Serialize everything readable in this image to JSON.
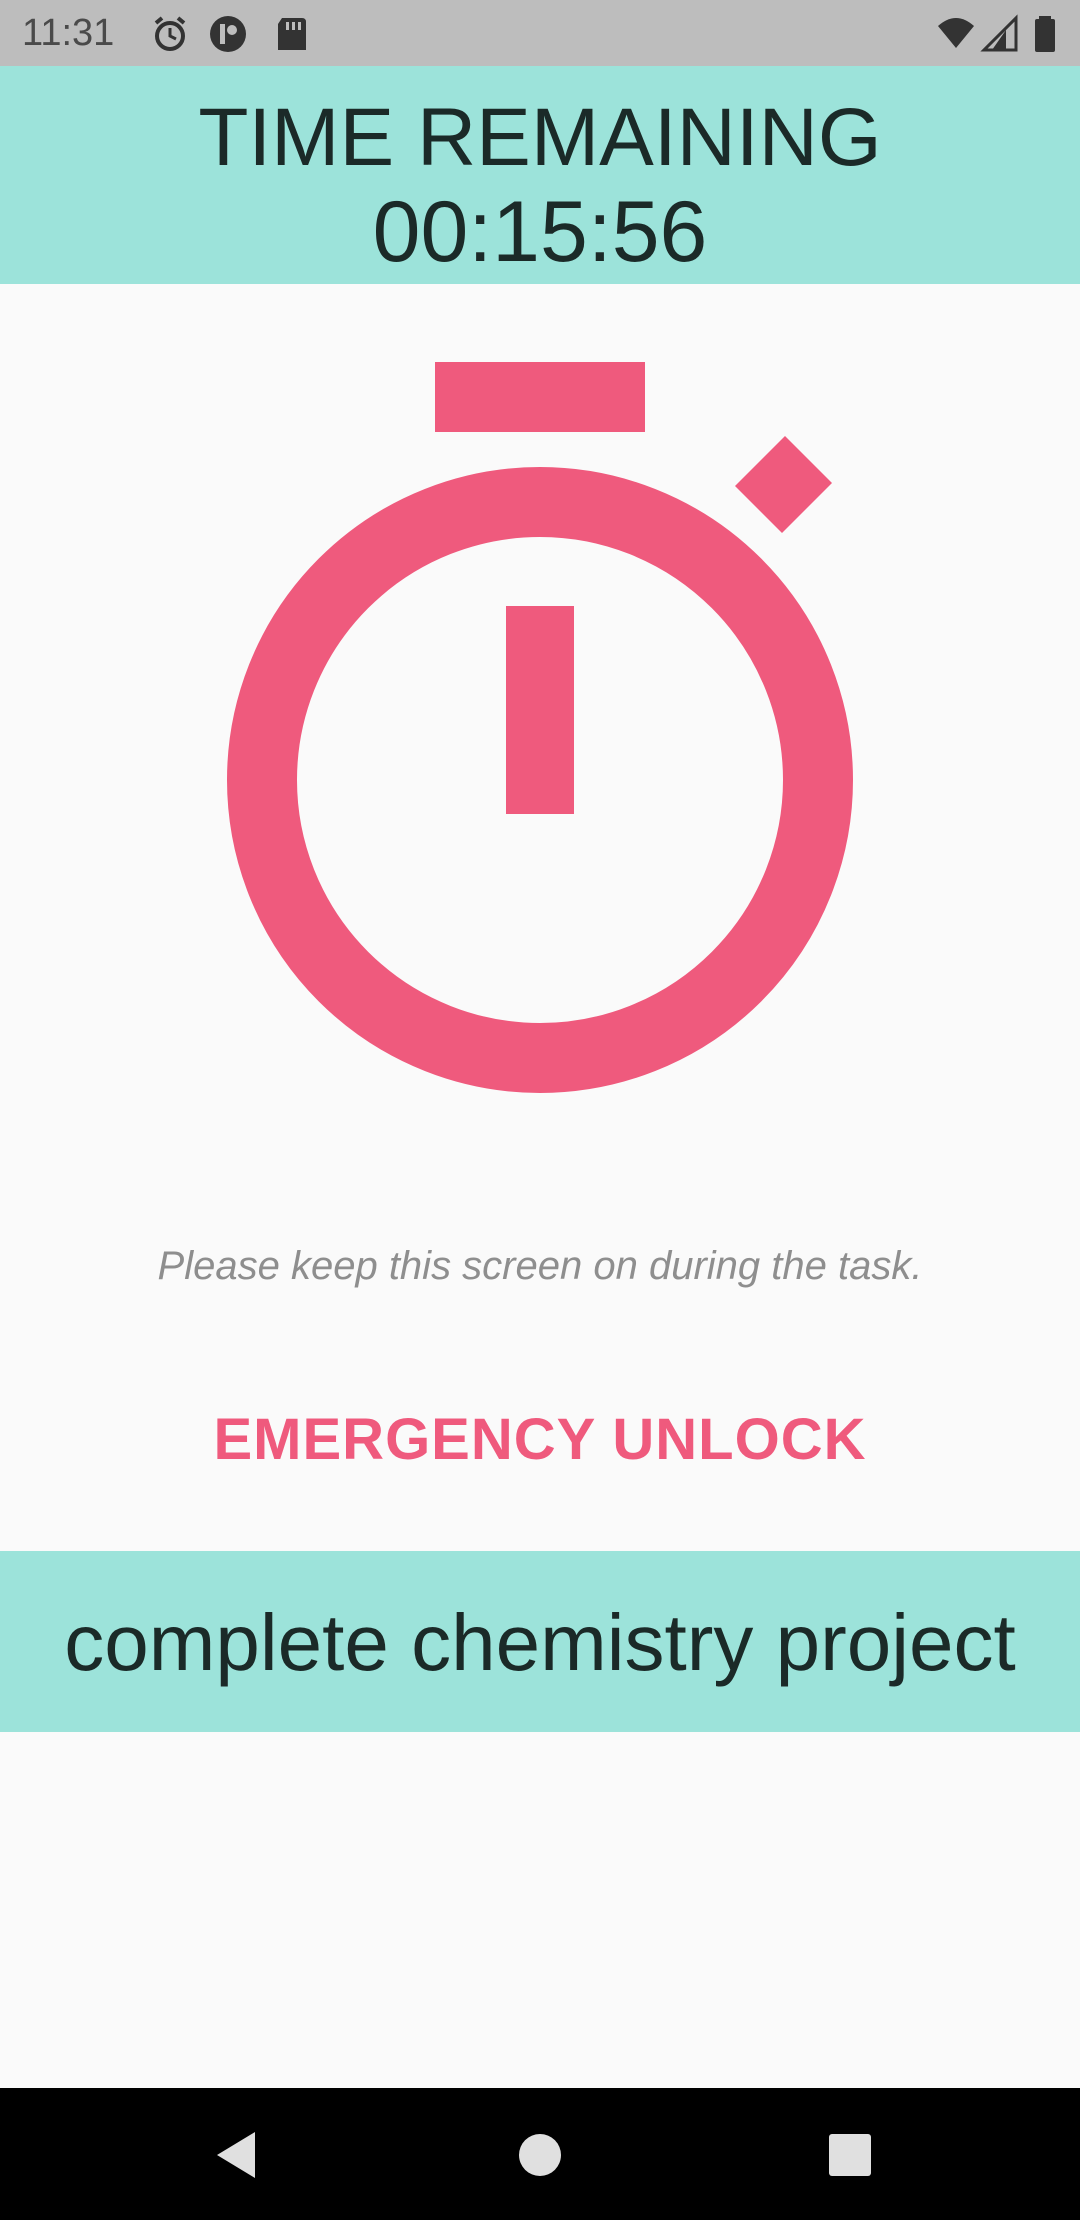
{
  "status_bar": {
    "time": "11:31",
    "icons_left": [
      "alarm-icon",
      "app-notification-icon",
      "sd-card-icon"
    ],
    "icons_right": [
      "wifi-icon",
      "signal-icon",
      "battery-icon"
    ]
  },
  "header": {
    "title": "TIME REMAINING",
    "countdown": "00:15:56"
  },
  "main": {
    "icon": "stopwatch-icon",
    "hint": "Please keep this screen on during the task.",
    "emergency_unlock_label": "EMERGENCY UNLOCK"
  },
  "task": {
    "name": "complete chemistry project"
  },
  "nav_bar": {
    "buttons": [
      "back-icon",
      "home-icon",
      "recents-icon"
    ]
  },
  "colors": {
    "accent": "#ef5a7d",
    "header_bg": "#9ce3da",
    "status_bar_bg": "#bdbdbd",
    "page_bg": "#fafafa"
  }
}
